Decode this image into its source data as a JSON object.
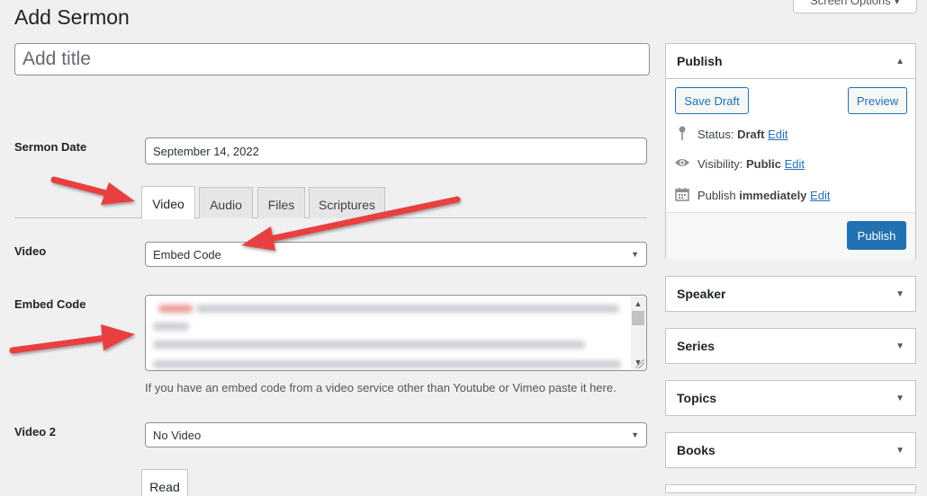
{
  "header": {
    "page_title": "Add Sermon",
    "screen_options_label": "Screen Options ▾"
  },
  "title_field": {
    "placeholder": "Add title",
    "value": ""
  },
  "sermon_date": {
    "label": "Sermon Date",
    "value": "September 14, 2022"
  },
  "tabs": [
    {
      "label": "Video",
      "active": true
    },
    {
      "label": "Audio",
      "active": false
    },
    {
      "label": "Files",
      "active": false
    },
    {
      "label": "Scriptures",
      "active": false
    }
  ],
  "video": {
    "label": "Video",
    "selected": "Embed Code"
  },
  "embed_code": {
    "label": "Embed Code",
    "help_text": "If you have an embed code from a video service other than Youtube or Vimeo paste it here."
  },
  "video2": {
    "label": "Video 2",
    "selected": "No Video"
  },
  "read_tab_label": "Read",
  "publish_box": {
    "title": "Publish",
    "save_draft_label": "Save Draft",
    "preview_label": "Preview",
    "status_label": "Status:",
    "status_value": "Draft",
    "visibility_label": "Visibility:",
    "visibility_value": "Public",
    "publish_label": "Publish",
    "publish_value": "immediately",
    "edit_label": "Edit",
    "publish_button_label": "Publish"
  },
  "sidebar_boxes": [
    {
      "title": "Speaker"
    },
    {
      "title": "Series"
    },
    {
      "title": "Topics"
    },
    {
      "title": "Books"
    }
  ],
  "icons": {
    "collapse": "triangle-up-icon",
    "expand": "triangle-down-icon",
    "status": "pin-icon",
    "visibility": "eye-icon",
    "schedule": "calendar-icon"
  },
  "colors": {
    "accent": "#2271b1",
    "annotation_arrow": "#e84040",
    "background": "#f0f0f1"
  }
}
